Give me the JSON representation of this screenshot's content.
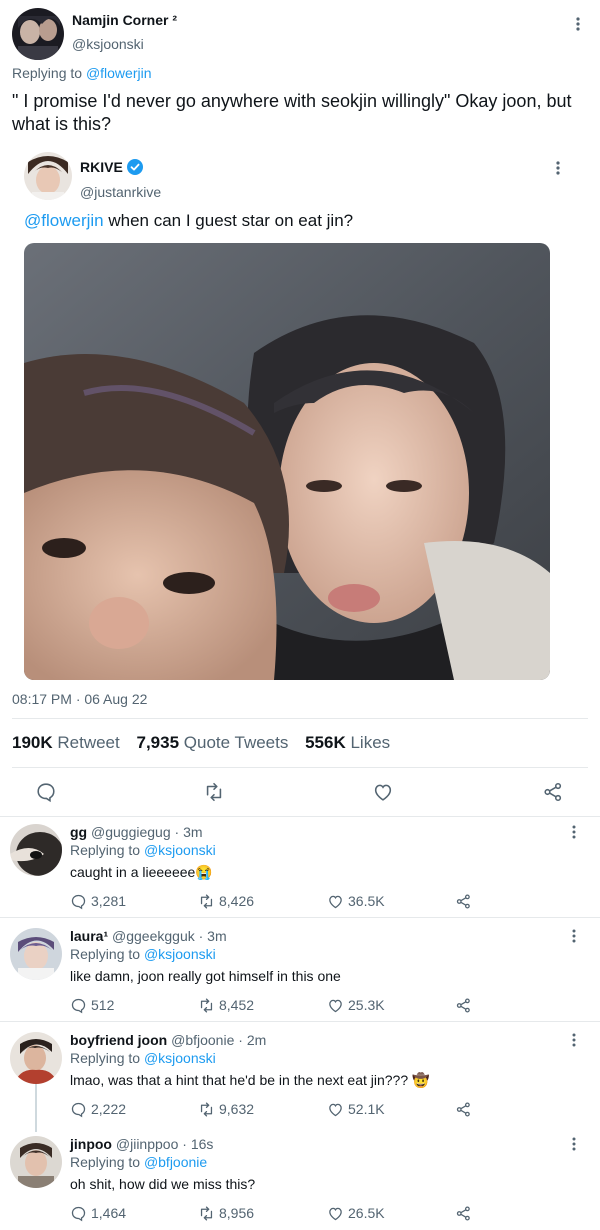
{
  "main_tweet": {
    "display_name": "Namjin Corner ²",
    "handle": "@ksjoonski",
    "replying_prefix": "Replying to",
    "replying_to": "@flowerjin",
    "text": "\" I promise I'd never go anywhere with seokjin willingly\" Okay joon, but what is this?"
  },
  "quoted_tweet": {
    "display_name": "RKIVE",
    "handle": "@justanrkive",
    "mention": "@flowerjin",
    "text": " when can I guest star on eat jin?"
  },
  "timestamp": "08:17 PM · 06 Aug 22",
  "stats": {
    "retweets_count": "190K",
    "retweets_label": "Retweet",
    "quotes_count": "7,935",
    "quotes_label": "Quote Tweets",
    "likes_count": "556K",
    "likes_label": "Likes"
  },
  "replies": [
    {
      "name": "gg",
      "handle": "@guggiegug",
      "time": "· 3m",
      "replying_prefix": "Replying to",
      "replying_to": "@ksjoonski",
      "text": "caught in a lieeeeee😭",
      "replies": "3,281",
      "retweets": "8,426",
      "likes": "36.5K"
    },
    {
      "name": "laura¹",
      "handle": "@ggeekgguk",
      "time": "· 3m",
      "replying_prefix": "Replying to",
      "replying_to": "@ksjoonski",
      "text": "like damn, joon really got himself in this one",
      "replies": "512",
      "retweets": "8,452",
      "likes": "25.3K"
    },
    {
      "name": "boyfriend joon",
      "handle": "@bfjoonie",
      "time": "· 2m",
      "replying_prefix": "Replying to",
      "replying_to": "@ksjoonski",
      "text": "lmao, was that a hint that he'd be in the next eat jin??? 🤠",
      "replies": "2,222",
      "retweets": "9,632",
      "likes": "52.1K"
    },
    {
      "name": "jinpoo",
      "handle": "@jiinppoo",
      "time": "· 16s",
      "replying_prefix": "Replying to",
      "replying_to": "@bfjoonie",
      "text": "oh shit, how did we miss this?",
      "replies": "1,464",
      "retweets": "8,956",
      "likes": "26.5K"
    }
  ],
  "colors": {
    "accent": "#1d9bf0",
    "text": "#0f1419",
    "muted": "#536471",
    "divider": "#e6e9eb"
  }
}
